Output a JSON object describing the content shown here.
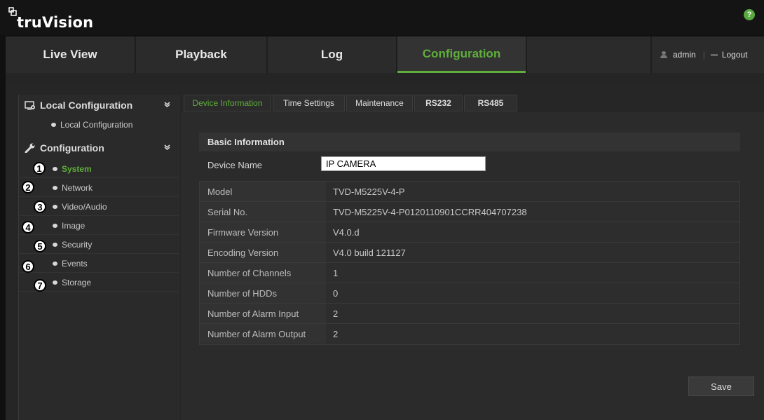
{
  "app": {
    "brand_name": "truVision",
    "help_glyph": "?"
  },
  "nav": {
    "tabs": [
      {
        "label": "Live View"
      },
      {
        "label": "Playback"
      },
      {
        "label": "Log"
      },
      {
        "label": "Configuration",
        "active": true
      }
    ],
    "user": "admin",
    "logout_label": "Logout"
  },
  "sidebar": {
    "local_header": "Local Configuration",
    "local_item": "Local Configuration",
    "config_header": "Configuration",
    "items": [
      {
        "label": "System",
        "callout": "1",
        "active": true
      },
      {
        "label": "Network",
        "callout": "2"
      },
      {
        "label": "Video/Audio",
        "callout": "3"
      },
      {
        "label": "Image",
        "callout": "4"
      },
      {
        "label": "Security",
        "callout": "5"
      },
      {
        "label": "Events",
        "callout": "6"
      },
      {
        "label": "Storage",
        "callout": "7"
      }
    ]
  },
  "content": {
    "tabs": [
      {
        "label": "Device Information",
        "active": true
      },
      {
        "label": "Time Settings"
      },
      {
        "label": "Maintenance"
      },
      {
        "label": "RS232"
      },
      {
        "label": "RS485"
      }
    ],
    "section_title": "Basic Information",
    "device_name_label": "Device Name",
    "device_name_value": "IP CAMERA",
    "rows": [
      {
        "label": "Model",
        "value": "TVD-M5225V-4-P"
      },
      {
        "label": "Serial No.",
        "value": "TVD-M5225V-4-P0120110901CCRR404707238"
      },
      {
        "label": "Firmware Version",
        "value": "V4.0.d"
      },
      {
        "label": "Encoding Version",
        "value": "V4.0 build 121127"
      },
      {
        "label": "Number of Channels",
        "value": "1"
      },
      {
        "label": "Number of HDDs",
        "value": "0"
      },
      {
        "label": "Number of Alarm Input",
        "value": "2"
      },
      {
        "label": "Number of Alarm Output",
        "value": "2"
      }
    ],
    "save_label": "Save"
  },
  "colors": {
    "accent": "#5fae3c",
    "background": "#262626",
    "header": "#141414"
  }
}
